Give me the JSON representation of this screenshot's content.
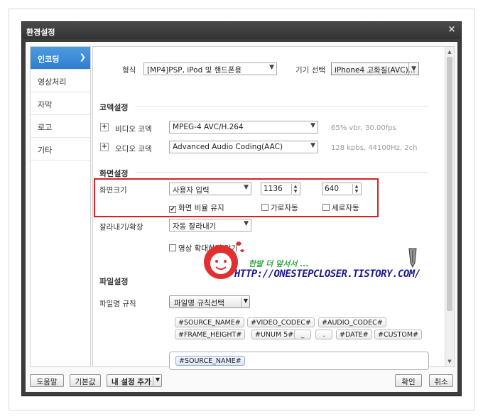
{
  "window": {
    "title": "환경설정",
    "close_symbol": "×"
  },
  "sidebar": {
    "items": [
      {
        "label": "인코딩",
        "active": true
      },
      {
        "label": "영상처리"
      },
      {
        "label": "자막"
      },
      {
        "label": "로고"
      },
      {
        "label": "기타"
      }
    ]
  },
  "format": {
    "label": "형식",
    "value": "[MP4]PSP, iPod 및 핸드폰용",
    "device_label": "기기 선택",
    "device_value": "iPhone4 고화질(AVC)..."
  },
  "codec": {
    "title": "코덱설정",
    "video_label": "비디오 코덱",
    "video_value": "MPEG-4 AVC/H.264",
    "video_hint": "65% vbr, 30.00fps",
    "audio_label": "오디오 코덱",
    "audio_value": "Advanced Audio Coding(AAC)",
    "audio_hint": "128 kpbs, 44100Hz, 2ch"
  },
  "screen": {
    "title": "화면설정",
    "size_label": "화면크기",
    "size_value": "사용자 입력",
    "width": "1136",
    "height": "640",
    "keep_ratio_label": "화면 비율 유지",
    "keep_ratio_checked": true,
    "auto_width_label": "가로자동",
    "auto_height_label": "세로자동",
    "crop_label": "잘라내기/확장",
    "crop_value": "자동 잘라내기",
    "upscale_label": "영상 확대하지 않기"
  },
  "file": {
    "title": "파일설정",
    "rule_label": "파일명 규칙",
    "rule_select": "파일명 규칙선택",
    "tokens_row1": [
      "#SOURCE_NAME#",
      "#VIDEO_CODEC#",
      "#AUDIO_CODEC#"
    ],
    "tokens_row2": [
      "#FRAME_HEIGHT#",
      "#UNUM 5#",
      "_",
      ".",
      "#DATE#",
      "#CUSTOM#"
    ],
    "current_token": "#SOURCE_NAME#"
  },
  "footer": {
    "help": "도움말",
    "default": "기본값",
    "add_preset": "내 설정 추가",
    "ok": "확인",
    "cancel": "취소"
  },
  "watermark": {
    "slogan": "한발 더 앞서서 ...",
    "url": "HTTP://ONESTEPCLOSER.TISTORY.COM/"
  },
  "colors": {
    "accent": "#3a8ad6",
    "highlight_border": "#d92020",
    "watermark_red": "#e03030",
    "watermark_green": "#3aa84a",
    "watermark_blue": "#1a1a8c"
  },
  "icons": {
    "sidebar_active": "chevron-right-icon",
    "dropdown": "chevron-down-icon",
    "spinner": "up-down-arrows-icon",
    "expand": "plus-icon"
  }
}
